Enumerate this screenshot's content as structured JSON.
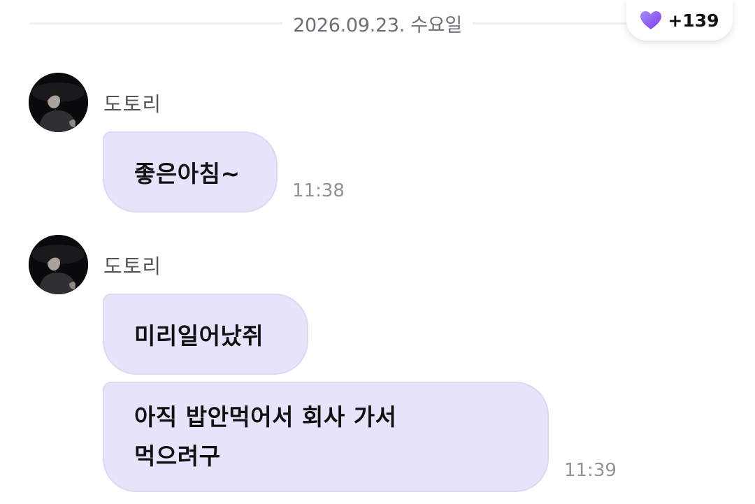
{
  "date_separator": "2026.09.23. 수요일",
  "reaction": {
    "icon": "purple-heart-icon",
    "color": "#8b5cf6",
    "count": "+139"
  },
  "bubble_color": "#e6e3fb",
  "messages": [
    {
      "sender": "도토리",
      "bubbles": [
        {
          "lines": [
            "좋은아침~"
          ],
          "time": "11:38"
        }
      ]
    },
    {
      "sender": "도토리",
      "bubbles": [
        {
          "lines": [
            "미리일어났쥐"
          ],
          "time": ""
        },
        {
          "lines": [
            "아직 밥안먹어서 회사 가서",
            "먹으려구"
          ],
          "time": "11:39"
        }
      ]
    }
  ]
}
